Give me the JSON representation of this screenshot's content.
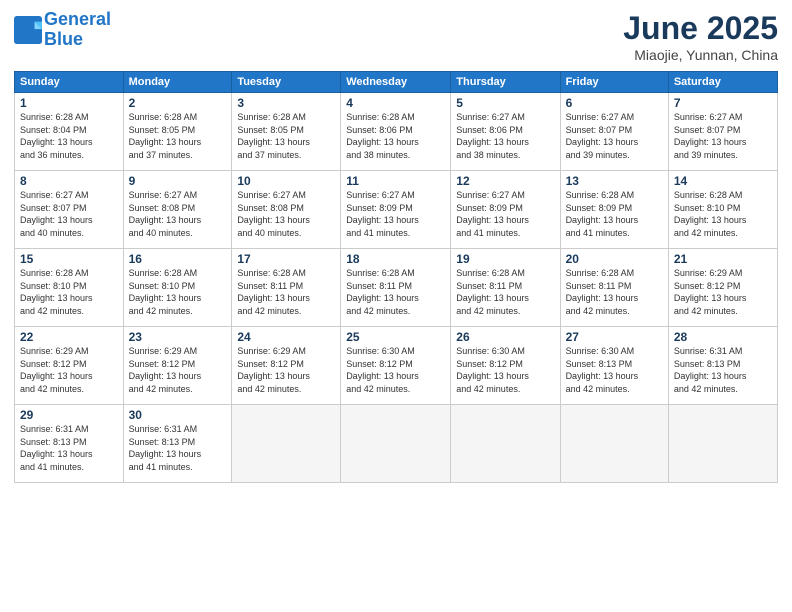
{
  "header": {
    "logo_line1": "General",
    "logo_line2": "Blue",
    "month_title": "June 2025",
    "location": "Miaojie, Yunnan, China"
  },
  "weekdays": [
    "Sunday",
    "Monday",
    "Tuesday",
    "Wednesday",
    "Thursday",
    "Friday",
    "Saturday"
  ],
  "weeks": [
    [
      {
        "day": "1",
        "info": "Sunrise: 6:28 AM\nSunset: 8:04 PM\nDaylight: 13 hours\nand 36 minutes."
      },
      {
        "day": "2",
        "info": "Sunrise: 6:28 AM\nSunset: 8:05 PM\nDaylight: 13 hours\nand 37 minutes."
      },
      {
        "day": "3",
        "info": "Sunrise: 6:28 AM\nSunset: 8:05 PM\nDaylight: 13 hours\nand 37 minutes."
      },
      {
        "day": "4",
        "info": "Sunrise: 6:28 AM\nSunset: 8:06 PM\nDaylight: 13 hours\nand 38 minutes."
      },
      {
        "day": "5",
        "info": "Sunrise: 6:27 AM\nSunset: 8:06 PM\nDaylight: 13 hours\nand 38 minutes."
      },
      {
        "day": "6",
        "info": "Sunrise: 6:27 AM\nSunset: 8:07 PM\nDaylight: 13 hours\nand 39 minutes."
      },
      {
        "day": "7",
        "info": "Sunrise: 6:27 AM\nSunset: 8:07 PM\nDaylight: 13 hours\nand 39 minutes."
      }
    ],
    [
      {
        "day": "8",
        "info": "Sunrise: 6:27 AM\nSunset: 8:07 PM\nDaylight: 13 hours\nand 40 minutes."
      },
      {
        "day": "9",
        "info": "Sunrise: 6:27 AM\nSunset: 8:08 PM\nDaylight: 13 hours\nand 40 minutes."
      },
      {
        "day": "10",
        "info": "Sunrise: 6:27 AM\nSunset: 8:08 PM\nDaylight: 13 hours\nand 40 minutes."
      },
      {
        "day": "11",
        "info": "Sunrise: 6:27 AM\nSunset: 8:09 PM\nDaylight: 13 hours\nand 41 minutes."
      },
      {
        "day": "12",
        "info": "Sunrise: 6:27 AM\nSunset: 8:09 PM\nDaylight: 13 hours\nand 41 minutes."
      },
      {
        "day": "13",
        "info": "Sunrise: 6:28 AM\nSunset: 8:09 PM\nDaylight: 13 hours\nand 41 minutes."
      },
      {
        "day": "14",
        "info": "Sunrise: 6:28 AM\nSunset: 8:10 PM\nDaylight: 13 hours\nand 42 minutes."
      }
    ],
    [
      {
        "day": "15",
        "info": "Sunrise: 6:28 AM\nSunset: 8:10 PM\nDaylight: 13 hours\nand 42 minutes."
      },
      {
        "day": "16",
        "info": "Sunrise: 6:28 AM\nSunset: 8:10 PM\nDaylight: 13 hours\nand 42 minutes."
      },
      {
        "day": "17",
        "info": "Sunrise: 6:28 AM\nSunset: 8:11 PM\nDaylight: 13 hours\nand 42 minutes."
      },
      {
        "day": "18",
        "info": "Sunrise: 6:28 AM\nSunset: 8:11 PM\nDaylight: 13 hours\nand 42 minutes."
      },
      {
        "day": "19",
        "info": "Sunrise: 6:28 AM\nSunset: 8:11 PM\nDaylight: 13 hours\nand 42 minutes."
      },
      {
        "day": "20",
        "info": "Sunrise: 6:28 AM\nSunset: 8:11 PM\nDaylight: 13 hours\nand 42 minutes."
      },
      {
        "day": "21",
        "info": "Sunrise: 6:29 AM\nSunset: 8:12 PM\nDaylight: 13 hours\nand 42 minutes."
      }
    ],
    [
      {
        "day": "22",
        "info": "Sunrise: 6:29 AM\nSunset: 8:12 PM\nDaylight: 13 hours\nand 42 minutes."
      },
      {
        "day": "23",
        "info": "Sunrise: 6:29 AM\nSunset: 8:12 PM\nDaylight: 13 hours\nand 42 minutes."
      },
      {
        "day": "24",
        "info": "Sunrise: 6:29 AM\nSunset: 8:12 PM\nDaylight: 13 hours\nand 42 minutes."
      },
      {
        "day": "25",
        "info": "Sunrise: 6:30 AM\nSunset: 8:12 PM\nDaylight: 13 hours\nand 42 minutes."
      },
      {
        "day": "26",
        "info": "Sunrise: 6:30 AM\nSunset: 8:12 PM\nDaylight: 13 hours\nand 42 minutes."
      },
      {
        "day": "27",
        "info": "Sunrise: 6:30 AM\nSunset: 8:13 PM\nDaylight: 13 hours\nand 42 minutes."
      },
      {
        "day": "28",
        "info": "Sunrise: 6:31 AM\nSunset: 8:13 PM\nDaylight: 13 hours\nand 42 minutes."
      }
    ],
    [
      {
        "day": "29",
        "info": "Sunrise: 6:31 AM\nSunset: 8:13 PM\nDaylight: 13 hours\nand 41 minutes."
      },
      {
        "day": "30",
        "info": "Sunrise: 6:31 AM\nSunset: 8:13 PM\nDaylight: 13 hours\nand 41 minutes."
      },
      {
        "day": "",
        "info": ""
      },
      {
        "day": "",
        "info": ""
      },
      {
        "day": "",
        "info": ""
      },
      {
        "day": "",
        "info": ""
      },
      {
        "day": "",
        "info": ""
      }
    ]
  ]
}
